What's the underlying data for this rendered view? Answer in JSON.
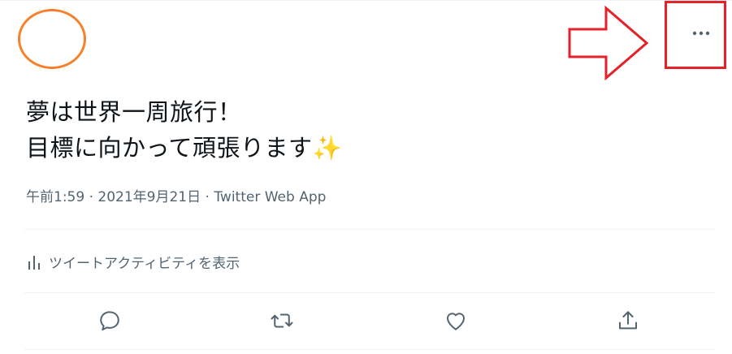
{
  "tweet": {
    "text_line1": "夢は世界一周旅行！",
    "text_line2": "目標に向かって頑張ります",
    "emoji": "✨",
    "time": "午前1:59",
    "separator": " · ",
    "date": "2021年9月21日",
    "source": "Twitter Web App"
  },
  "activity": {
    "label": "ツイートアクティビティを表示",
    "icon": "bar-chart-icon"
  },
  "actions": {
    "reply_icon": "reply-icon",
    "retweet_icon": "retweet-icon",
    "like_icon": "heart-icon",
    "share_icon": "share-icon"
  },
  "more": {
    "icon": "more-dots-icon"
  },
  "annotations": {
    "circle_color": "#f5822a",
    "highlight_color": "#e5212a"
  },
  "colors": {
    "text_primary": "#0f1419",
    "text_secondary": "#536471",
    "border": "#eff3f4"
  }
}
